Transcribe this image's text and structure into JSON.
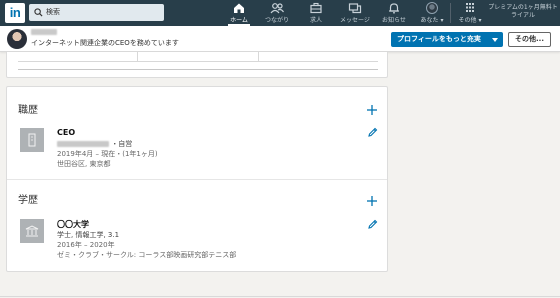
{
  "nav": {
    "logo": "in",
    "search": {
      "value": "検索"
    },
    "items": [
      {
        "label": "ホーム",
        "icon": "home-icon"
      },
      {
        "label": "つながり",
        "icon": "network-icon"
      },
      {
        "label": "求人",
        "icon": "jobs-icon"
      },
      {
        "label": "メッセージ",
        "icon": "messaging-icon"
      },
      {
        "label": "お知らせ",
        "icon": "notifications-icon"
      },
      {
        "label": "あなた ▾",
        "icon": "profile-avatar"
      },
      {
        "label": "その他 ▾",
        "icon": "grid-icon"
      }
    ],
    "premium": "プレミアムの1ヶ月無料トライアル"
  },
  "profile_bar": {
    "headline": "インターネット関連企業のCEOを務めています",
    "primary_button": "プロフィールをもっと充実",
    "secondary_button": "その他..."
  },
  "experience": {
    "title": "職歴",
    "entries": [
      {
        "role": "CEO",
        "employment_type": "・自営",
        "dates": "2019年4月 – 現在・(1年1ヶ月)",
        "location": "世田谷区, 東京都"
      }
    ]
  },
  "education": {
    "title": "学歴",
    "entries": [
      {
        "school": "〇〇大学",
        "degree": "学士, 情報工学, 3.1",
        "dates": "2016年 – 2020年",
        "activities": "ゼミ・クラブ・サークル: コーラス部映画研究部テニス部"
      }
    ]
  },
  "colors": {
    "nav_bg": "#283e4a",
    "brand_blue": "#0073b1",
    "page_bg": "#f3f2ef"
  }
}
